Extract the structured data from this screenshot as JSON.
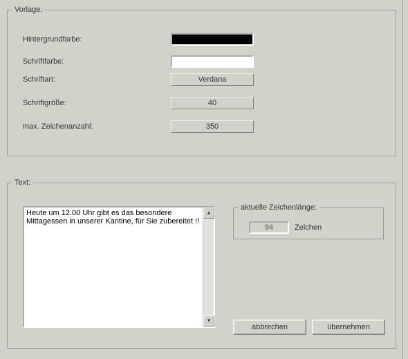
{
  "vorlage": {
    "legend": "Vorlage:",
    "bgcolor_label": "Hintergrundfarbe:",
    "bgcolor_value": "#000000",
    "fgcolor_label": "Schriftfarbe:",
    "fgcolor_value": "#FFFFFF",
    "font_label": "Schriftart:",
    "font_value": "Verdana",
    "size_label": "Schriftgröße:",
    "size_value": "40",
    "max_label": "max. Zeichenanzahl:",
    "max_value": "350"
  },
  "text": {
    "legend": "Text:",
    "content": "Heute um 12.00 Uhr gibt es das besondere Mittagessen in unserer Kantine, für Sie zubereitet !!",
    "count_legend": "aktuelle Zeichenlänge:",
    "count_value": "94",
    "count_unit": "Zeichen",
    "cancel": "abbrechen",
    "apply": "übernehmen"
  }
}
